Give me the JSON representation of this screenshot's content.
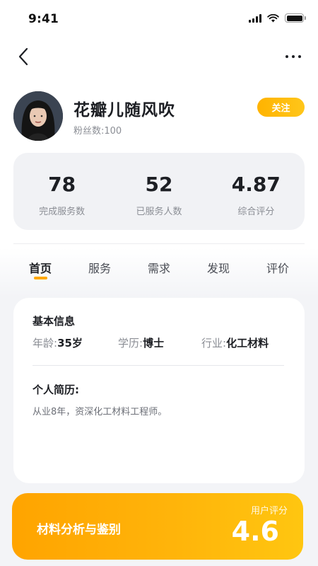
{
  "status_bar": {
    "time": "9:41"
  },
  "nav": {
    "back_icon": "chevron-left-icon",
    "more_icon": "more-horizontal-icon"
  },
  "profile": {
    "name": "花瓣儿随风吹",
    "fans_label": "粉丝数:",
    "fans_count": "100",
    "follow_label": "关注"
  },
  "stats": [
    {
      "value": "78",
      "label": "完成服务数"
    },
    {
      "value": "52",
      "label": "已服务人数"
    },
    {
      "value": "4.87",
      "label": "综合评分"
    }
  ],
  "tabs": [
    {
      "label": "首页",
      "active": true
    },
    {
      "label": "服务",
      "active": false
    },
    {
      "label": "需求",
      "active": false
    },
    {
      "label": "发现",
      "active": false
    },
    {
      "label": "评价",
      "active": false
    }
  ],
  "basic_info": {
    "title": "基本信息",
    "items": [
      {
        "label": "年龄:",
        "value": "35岁"
      },
      {
        "label": "学历:",
        "value": "博士"
      },
      {
        "label": "行业:",
        "value": "化工材料"
      }
    ]
  },
  "resume": {
    "title": "个人简历:",
    "text": "从业8年，资深化工材料工程师。"
  },
  "service_banner": {
    "title": "材料分析与鉴别",
    "rating_label": "用户评分",
    "rating_value": "4.6"
  },
  "colors": {
    "accent": "#ffa800",
    "card_bg": "#f1f2f5",
    "text_primary": "#1d1f24",
    "text_secondary": "#8b8e95"
  }
}
